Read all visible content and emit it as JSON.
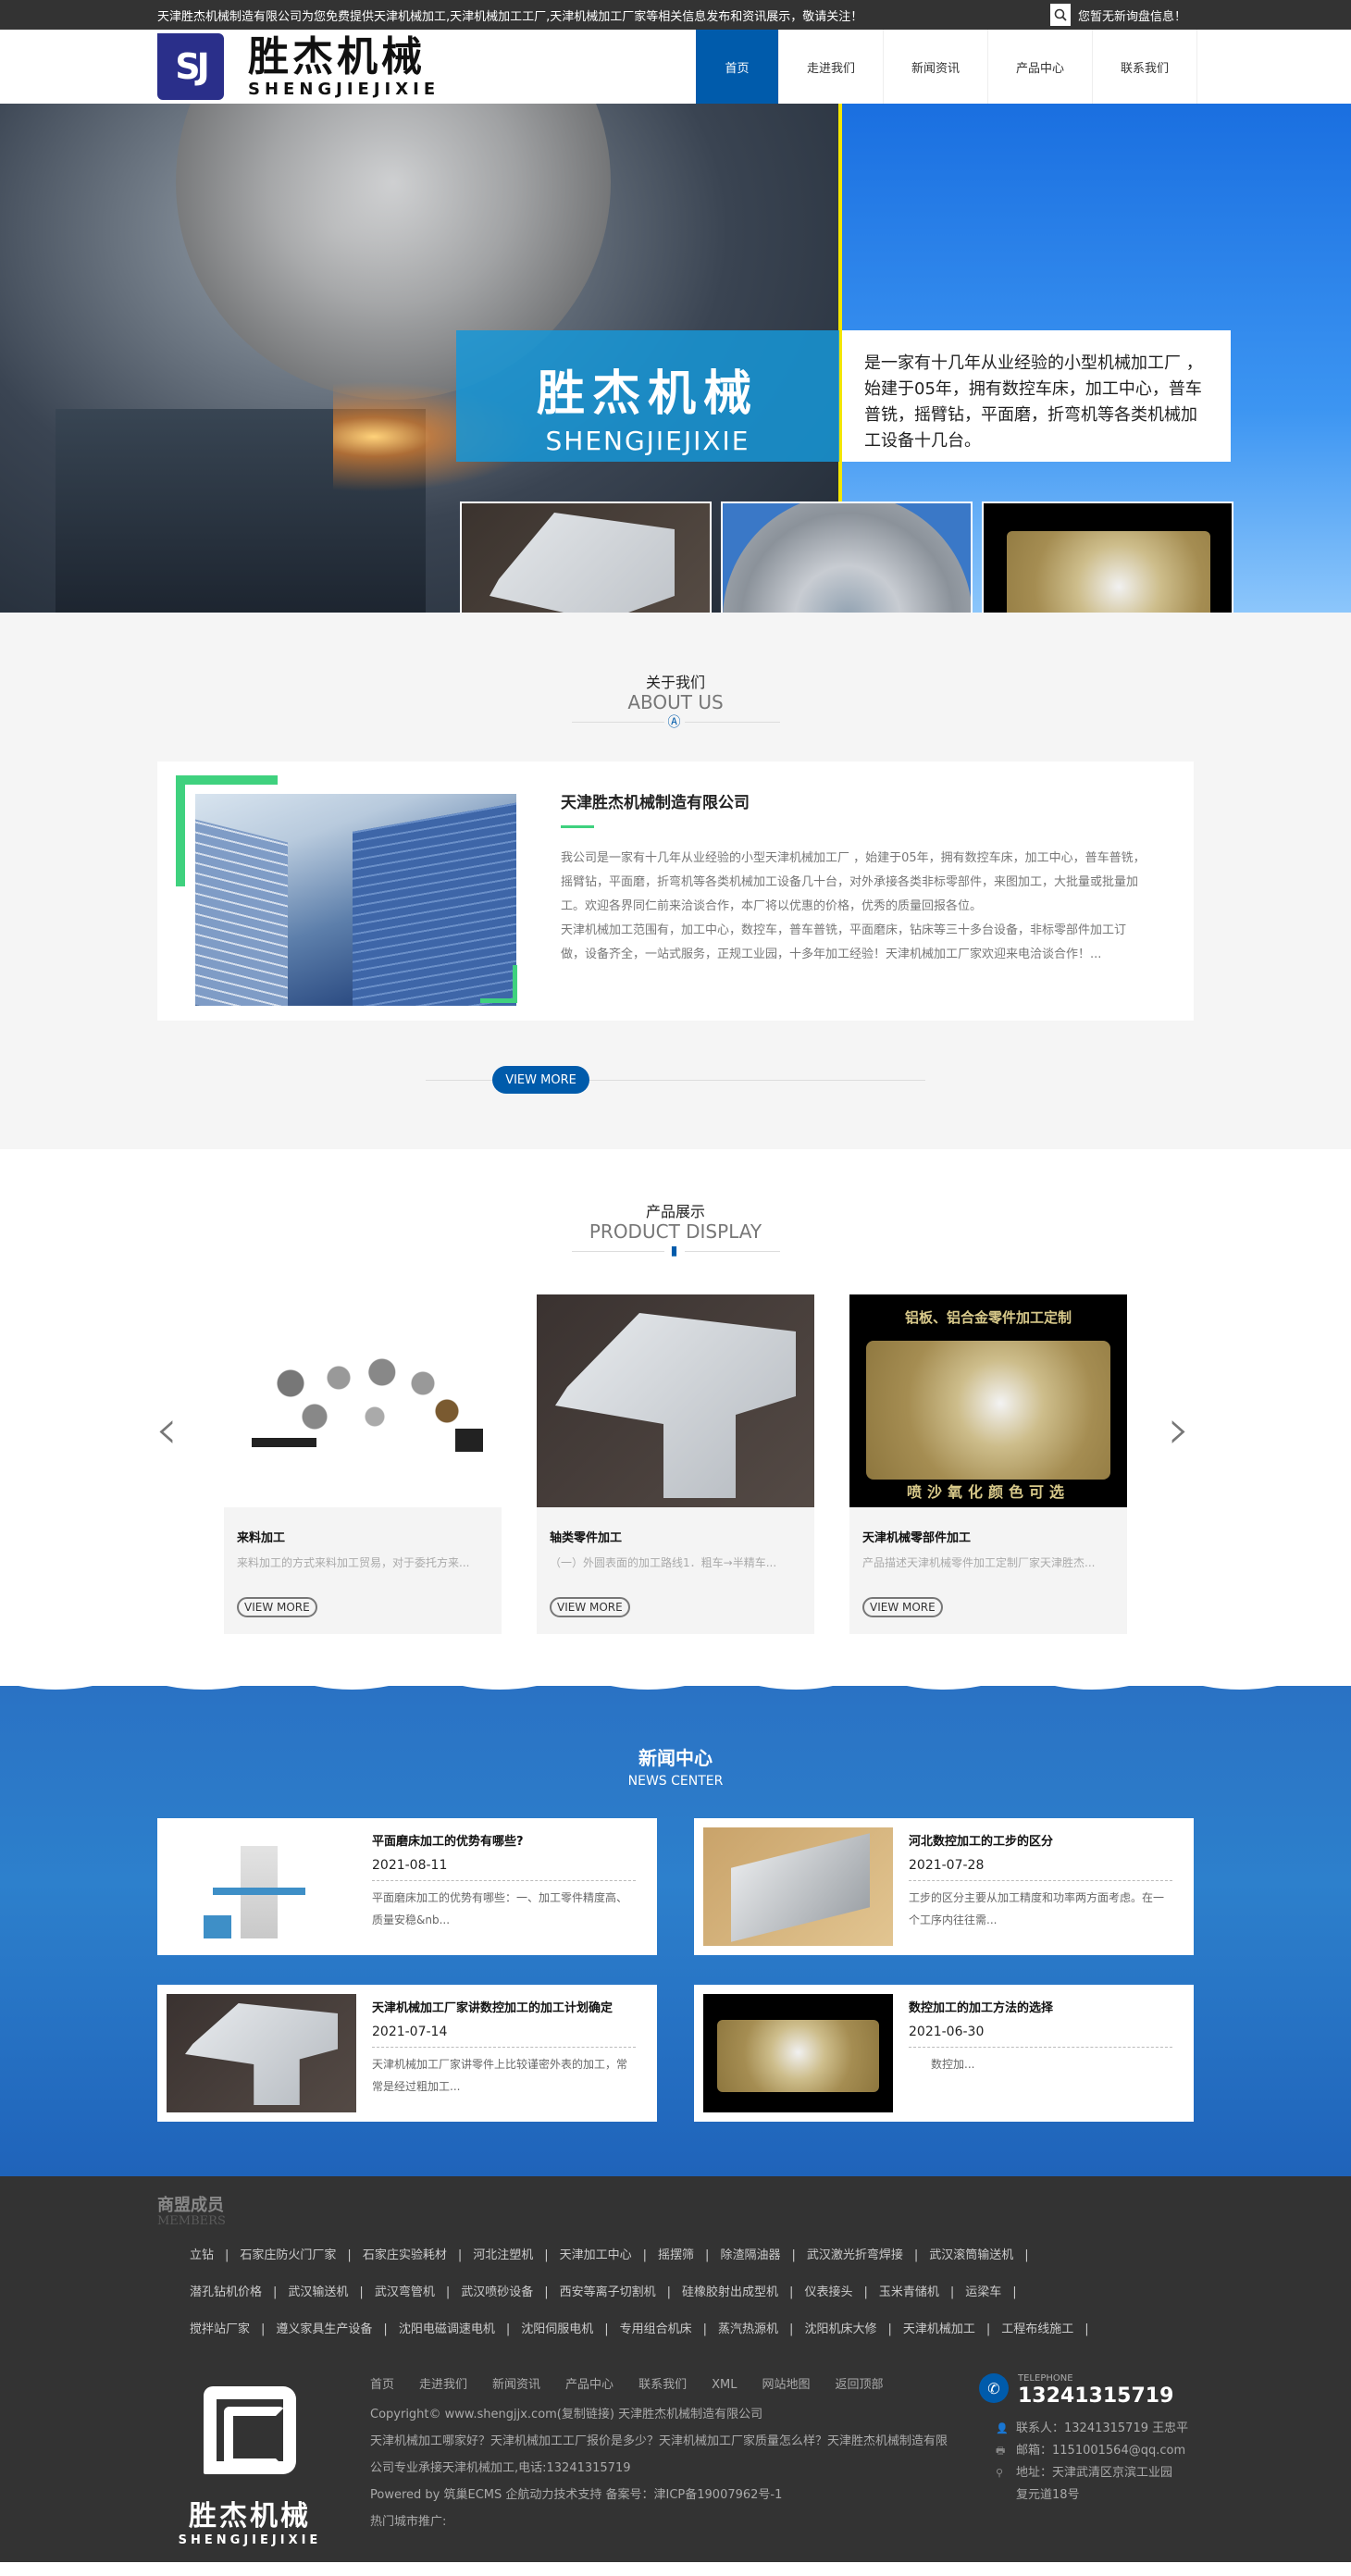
{
  "topbar": {
    "notice": "天津胜杰机械制造有限公司为您免费提供天津机械加工,天津机械加工工厂,天津机械加工厂家等相关信息发布和资讯展示，敬请关注！",
    "search_icon": "search-icon",
    "message": "您暂无新询盘信息！"
  },
  "header": {
    "logo_mark": "SJ",
    "logo_cn": "胜杰机械",
    "logo_en": "SHENGJIEJIXIE",
    "nav": [
      {
        "label": "首页",
        "active": true
      },
      {
        "label": "走进我们",
        "active": false
      },
      {
        "label": "新闻资讯",
        "active": false
      },
      {
        "label": "产品中心",
        "active": false
      },
      {
        "label": "联系我们",
        "active": false
      }
    ]
  },
  "banner": {
    "title_cn": "胜杰机械",
    "title_en": "SHENGJIEJIXIE",
    "description": "是一家有十几年从业经验的小型机械加工厂 ，始建于05年，拥有数控车床，加工中心，普车普铣，摇臂钻，平面磨，折弯机等各类机械加工设备十几台。",
    "slides_total": 2,
    "slide_active": 1
  },
  "about": {
    "title_cn": "关于我们",
    "title_en": "ABOUT US",
    "company": "天津胜杰机械制造有限公司",
    "paragraph1": "我公司是一家有十几年从业经验的小型天津机械加工厂 ，始建于05年，拥有数控车床，加工中心，普车普铣，摇臂钻，平面磨，折弯机等各类机械加工设备几十台，对外承接各类非标零部件，来图加工，大批量或批量加工。欢迎各界同仁前来洽谈合作，本厂将以优惠的价格，优秀的质量回报各位。",
    "paragraph2": "天津机械加工范围有，加工中心，数控车，普车普铣，平面磨床，钻床等三十多台设备，非标零部件加工订做，设备齐全，一站式服务，正规工业园，十多年加工经验！天津机械加工厂家欢迎来电洽谈合作！...",
    "view_more": "VIEW MORE"
  },
  "products": {
    "title_cn": "产品展示",
    "title_en": "PRODUCT DISPLAY",
    "prev_icon": "chevron-left-icon",
    "next_icon": "chevron-right-icon",
    "items": [
      {
        "name": "来料加工",
        "desc": "来料加工的方式来料加工贸易，对于委托方来...",
        "button": "VIEW MORE"
      },
      {
        "name": "轴类零件加工",
        "desc": "（一）外圆表面的加工路线1．粗车→半精车...",
        "button": "VIEW MORE"
      },
      {
        "name": "天津机械零部件加工",
        "desc": "产品描述天津机械零件加工定制厂家天津胜杰...",
        "button": "VIEW MORE",
        "img_caption_bottom": "喷沙氧化颜色可选"
      }
    ]
  },
  "news": {
    "title_cn": "新闻中心",
    "title_en": "NEWS CENTER",
    "items": [
      {
        "title": "平面磨床加工的优势有哪些?",
        "date": "2021-08-11",
        "summary": "平面磨床加工的优势有哪些：一、加工零件精度高、质量安稳&nb..."
      },
      {
        "title": "河北数控加工的工步的区分",
        "date": "2021-07-28",
        "summary": "工步的区分主要从加工精度和功率两方面考虑。在一个工序内往往需..."
      },
      {
        "title": "天津机械加工厂家讲数控加工的加工计划确定",
        "date": "2021-07-14",
        "summary": "天津机械加工厂家讲零件上比较谨密外表的加工，常常是经过粗加工..."
      },
      {
        "title": "数控加工的加工方法的选择",
        "date": "2021-06-30",
        "summary": "　　数控加..."
      }
    ]
  },
  "members": {
    "title_cn": "商盟成员",
    "title_en": "MEMBERS",
    "rows": [
      [
        "立钻",
        "石家庄防火门厂家",
        "石家庄实验耗材",
        "河北注塑机",
        "天津加工中心",
        "摇摆筛",
        "除渣隔油器",
        "武汉激光折弯焊接",
        "武汉滚筒输送机"
      ],
      [
        "潜孔钻机价格",
        "武汉输送机",
        "武汉弯管机",
        "武汉喷砂设备",
        "西安等离子切割机",
        "硅橡胶射出成型机",
        "仪表接头",
        "玉米青储机",
        "运梁车"
      ],
      [
        "搅拌站厂家",
        "遵义家具生产设备",
        "沈阳电磁调速电机",
        "沈阳伺服电机",
        "专用组合机床",
        "蒸汽热源机",
        "沈阳机床大修",
        "天津机械加工",
        "工程布线施工"
      ]
    ]
  },
  "footer": {
    "logo_cn": "胜杰机械",
    "logo_en": "SHENGJIEJIXIE",
    "links": [
      "首页",
      "走进我们",
      "新闻资讯",
      "产品中心",
      "联系我们",
      "XML",
      "网站地图",
      "返回顶部"
    ],
    "copyright": "Copyright© www.shengjjx.com(复制链接) 天津胜杰机械制造有限公司",
    "seo_text": "天津机械加工哪家好？天津机械加工工厂报价是多少？天津机械加工厂家质量怎么样？天津胜杰机械制造有限公司专业承接天津机械加工,电话:13241315719",
    "powered": "Powered by 筑巢ECMS  企航动力技术支持 备案号：津ICP备19007962号-1",
    "hot_cities": "热门城市推广:",
    "tel_label": "TELEPHONE",
    "tel": "13241315719",
    "contact": "联系人：13241315719 王忠平",
    "email": "邮箱：1151001564@qq.com",
    "address": "地址：天津武清区京滨工业园复元道18号"
  }
}
